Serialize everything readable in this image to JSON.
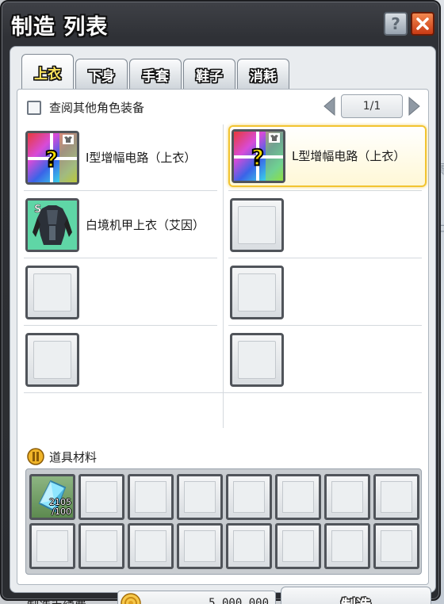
{
  "window": {
    "title": "制造 列表"
  },
  "header_buttons": {
    "help": "?"
  },
  "tabs": [
    {
      "label": "上衣",
      "active": true
    },
    {
      "label": "下身",
      "active": false
    },
    {
      "label": "手套",
      "active": false
    },
    {
      "label": "鞋子",
      "active": false
    },
    {
      "label": "消耗",
      "active": false
    }
  ],
  "filter": {
    "view_other_label": "查阅其他角色装备"
  },
  "pagination": {
    "label": "1/1"
  },
  "items": [
    {
      "name": "I型增幅电路（上衣）",
      "icon": "mystery-box-icon",
      "selected": false
    },
    {
      "name": "L型增幅电路（上衣）",
      "icon": "mystery-box-icon",
      "selected": true
    },
    {
      "name": "白境机甲上衣（艾因）",
      "icon": "armor-top-icon",
      "selected": false
    }
  ],
  "materials": {
    "title": "道具材料",
    "first_item": {
      "icon": "crystal-icon",
      "count_line1": "2105",
      "count_line2": "/100"
    }
  },
  "fee": {
    "label": "制造手续费",
    "value": "5,000,000"
  },
  "make_button": {
    "label": "制造"
  },
  "colors": {
    "selected_border": "#f2c431",
    "close_button": "#d8481f",
    "tab_active_text": "#ffe45c"
  }
}
